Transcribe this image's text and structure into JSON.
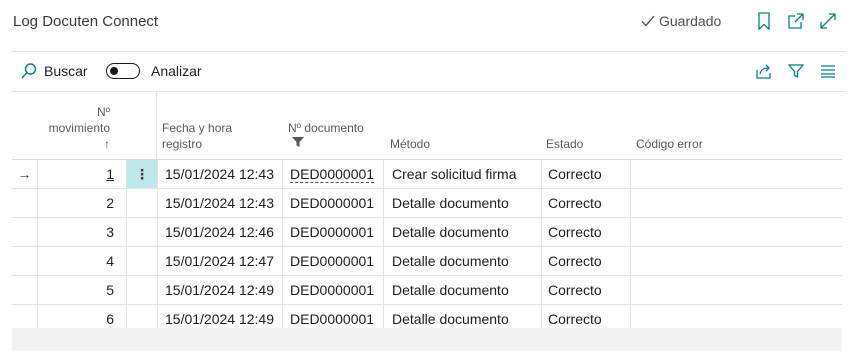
{
  "page": {
    "title": "Log Docuten Connect",
    "saved_status": "Guardado",
    "accent_color": "#008489",
    "selected_cell_color": "#bfe8ed"
  },
  "header_icons": [
    "bookmark-icon",
    "open-in-new-window-icon",
    "expand-icon"
  ],
  "actionbar": {
    "search_label": "Buscar",
    "analyze_label": "Analizar",
    "analyze_on": false,
    "right_icons": [
      "share-icon",
      "filter-icon",
      "list-view-icon"
    ]
  },
  "grid": {
    "headers": {
      "num_line1": "Nº",
      "num_line2": "movimiento",
      "num_sort": "↑",
      "fecha_line1": "Fecha y hora",
      "fecha_line2": "registro",
      "doc": "Nº documento",
      "metodo": "Método",
      "estado": "Estado",
      "error": "Código error"
    },
    "rows": [
      {
        "arrow": "→",
        "num": "1",
        "dots": "⋮",
        "fecha": "15/01/2024 12:43",
        "doc": "DED0000001",
        "metodo": "Crear solicitud firma",
        "estado": "Correcto",
        "error": ""
      },
      {
        "arrow": "",
        "num": "2",
        "dots": "",
        "fecha": "15/01/2024 12:43",
        "doc": "DED0000001",
        "metodo": "Detalle documento",
        "estado": "Correcto",
        "error": ""
      },
      {
        "arrow": "",
        "num": "3",
        "dots": "",
        "fecha": "15/01/2024 12:46",
        "doc": "DED0000001",
        "metodo": "Detalle documento",
        "estado": "Correcto",
        "error": ""
      },
      {
        "arrow": "",
        "num": "4",
        "dots": "",
        "fecha": "15/01/2024 12:47",
        "doc": "DED0000001",
        "metodo": "Detalle documento",
        "estado": "Correcto",
        "error": ""
      },
      {
        "arrow": "",
        "num": "5",
        "dots": "",
        "fecha": "15/01/2024 12:49",
        "doc": "DED0000001",
        "metodo": "Detalle documento",
        "estado": "Correcto",
        "error": ""
      },
      {
        "arrow": "",
        "num": "6",
        "dots": "",
        "fecha": "15/01/2024 12:49",
        "doc": "DED0000001",
        "metodo": "Detalle documento",
        "estado": "Correcto",
        "error": ""
      }
    ]
  }
}
